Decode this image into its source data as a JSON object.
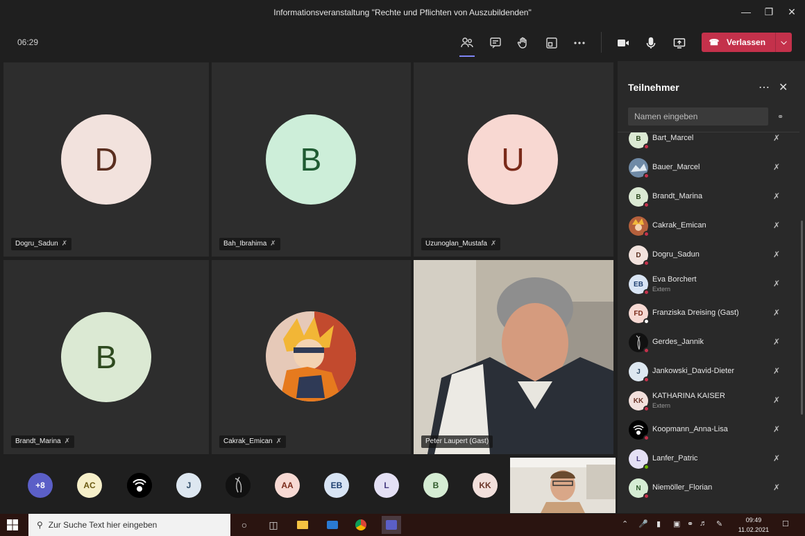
{
  "window": {
    "title": "Informationsveranstaltung \"Rechte und Pflichten von Auszubildenden\""
  },
  "toolbar": {
    "timer": "06:29",
    "leave_label": "Verlassen"
  },
  "tiles": [
    {
      "initial": "D",
      "name": "Dogru_Sadun",
      "bg": "#f2e2dd",
      "fg": "#5a2e1f"
    },
    {
      "initial": "B",
      "name": "Bah_Ibrahima",
      "bg": "#cdeed9",
      "fg": "#1f5b32"
    },
    {
      "initial": "U",
      "name": "Uzunoglan_Mustafa",
      "bg": "#f8d8d2",
      "fg": "#7a2a1a"
    },
    {
      "initial": "B",
      "name": "Brandt_Marina",
      "bg": "#dbe9d3",
      "fg": "#2e4a1f"
    },
    {
      "initial": "",
      "name": "Cakrak_Emican",
      "bg": "#c46a43",
      "fg": "#fff"
    },
    {
      "initial": "",
      "name": "Peter Laupert (Gast)",
      "bg": "",
      "fg": ""
    }
  ],
  "strip": [
    {
      "label": "+8",
      "bg": "#5b5fc7",
      "fg": "#ffffff"
    },
    {
      "label": "AC",
      "bg": "#f6efc9",
      "fg": "#6b5a12"
    },
    {
      "label": "",
      "bg": "#000000",
      "fg": "#ffffff"
    },
    {
      "label": "J",
      "bg": "#dde7f0",
      "fg": "#2d4a66"
    },
    {
      "label": "",
      "bg": "#111111",
      "fg": "#ffffff"
    },
    {
      "label": "AA",
      "bg": "#f7d9d3",
      "fg": "#7a2a1a"
    },
    {
      "label": "EB",
      "bg": "#d8e4f4",
      "fg": "#1e3f70"
    },
    {
      "label": "L",
      "bg": "#e4e0f4",
      "fg": "#463a80"
    },
    {
      "label": "B",
      "bg": "#d5ecd3",
      "fg": "#2e5a2a"
    },
    {
      "label": "KK",
      "bg": "#f2e0dc",
      "fg": "#6a3428"
    }
  ],
  "panel": {
    "title": "Teilnehmer",
    "search_placeholder": "Namen eingeben",
    "participants": [
      {
        "initials": "B",
        "name": "Bart_Marcel",
        "sub": "",
        "bg": "#dbe9d3",
        "fg": "#2e4a1f"
      },
      {
        "initials": "",
        "name": "Bauer_Marcel",
        "sub": "",
        "bg": "#6f8aa6",
        "fg": "#fff"
      },
      {
        "initials": "B",
        "name": "Brandt_Marina",
        "sub": "",
        "bg": "#dbe9d3",
        "fg": "#2e4a1f"
      },
      {
        "initials": "",
        "name": "Cakrak_Emican",
        "sub": "",
        "bg": "#b5603c",
        "fg": "#fff"
      },
      {
        "initials": "D",
        "name": "Dogru_Sadun",
        "sub": "",
        "bg": "#f2e2dd",
        "fg": "#5a2e1f"
      },
      {
        "initials": "EB",
        "name": "Eva Borchert",
        "sub": "Extern",
        "bg": "#d8e4f4",
        "fg": "#1e3f70"
      },
      {
        "initials": "FD",
        "name": "Franziska Dreising (Gast)",
        "sub": "",
        "bg": "#f7d9d3",
        "fg": "#7a2a1a"
      },
      {
        "initials": "",
        "name": "Gerdes_Jannik",
        "sub": "",
        "bg": "#111111",
        "fg": "#fff"
      },
      {
        "initials": "J",
        "name": "Jankowski_David-Dieter",
        "sub": "",
        "bg": "#dde7f0",
        "fg": "#2d4a66"
      },
      {
        "initials": "KK",
        "name": "KATHARINA KAISER",
        "sub": "Extern",
        "bg": "#f2e0dc",
        "fg": "#6a3428"
      },
      {
        "initials": "",
        "name": "Koopmann_Anna-Lisa",
        "sub": "",
        "bg": "#000000",
        "fg": "#fff"
      },
      {
        "initials": "L",
        "name": "Lanfer_Patric",
        "sub": "",
        "bg": "#e4e0f4",
        "fg": "#463a80"
      },
      {
        "initials": "N",
        "name": "Niemöller_Florian",
        "sub": "",
        "bg": "#d5ecd3",
        "fg": "#2e5a2a"
      }
    ]
  },
  "taskbar": {
    "search_placeholder": "Zur Suche Text hier eingeben",
    "time": "09:49",
    "date": "11.02.2021"
  }
}
